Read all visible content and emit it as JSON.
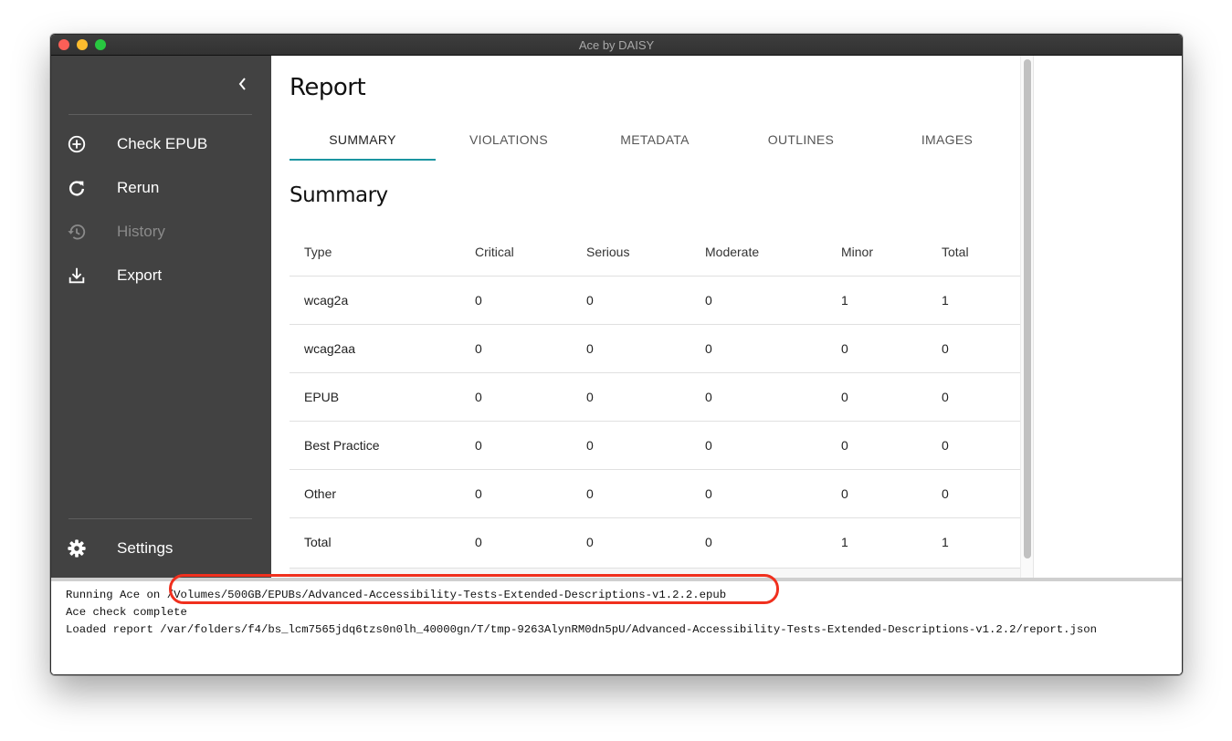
{
  "window": {
    "title": "Ace by DAISY"
  },
  "sidebar": {
    "collapse_icon": "chevron-left-icon",
    "items": [
      {
        "label": "Check EPUB",
        "icon": "add-circle-icon",
        "enabled": true
      },
      {
        "label": "Rerun",
        "icon": "refresh-icon",
        "enabled": true
      },
      {
        "label": "History",
        "icon": "history-icon",
        "enabled": false
      },
      {
        "label": "Export",
        "icon": "download-icon",
        "enabled": true
      }
    ],
    "settings": {
      "label": "Settings",
      "icon": "gear-icon"
    }
  },
  "report": {
    "title": "Report",
    "tabs": [
      {
        "label": "SUMMARY",
        "active": true
      },
      {
        "label": "VIOLATIONS",
        "active": false
      },
      {
        "label": "METADATA",
        "active": false
      },
      {
        "label": "OUTLINES",
        "active": false
      },
      {
        "label": "IMAGES",
        "active": false
      }
    ],
    "accent_color": "#1b95a1",
    "summary": {
      "title": "Summary",
      "columns": [
        "Type",
        "Critical",
        "Serious",
        "Moderate",
        "Minor",
        "Total"
      ],
      "rows": [
        [
          "wcag2a",
          "0",
          "0",
          "0",
          "1",
          "1"
        ],
        [
          "wcag2aa",
          "0",
          "0",
          "0",
          "0",
          "0"
        ],
        [
          "EPUB",
          "0",
          "0",
          "0",
          "0",
          "0"
        ],
        [
          "Best Practice",
          "0",
          "0",
          "0",
          "0",
          "0"
        ],
        [
          "Other",
          "0",
          "0",
          "0",
          "0",
          "0"
        ],
        [
          "Total",
          "0",
          "0",
          "0",
          "1",
          "1"
        ]
      ]
    }
  },
  "console": {
    "lines": [
      "Running Ace on /Volumes/500GB/EPUBs/Advanced-Accessibility-Tests-Extended-Descriptions-v1.2.2.epub",
      "Ace check complete",
      "Loaded report /var/folders/f4/bs_lcm7565jdq6tzs0n0lh_40000gn/T/tmp-9263AlynRM0dn5pU/Advanced-Accessibility-Tests-Extended-Descriptions-v1.2.2/report.json"
    ]
  },
  "annotation": {
    "color": "#f0301e",
    "target": "epub-path"
  }
}
